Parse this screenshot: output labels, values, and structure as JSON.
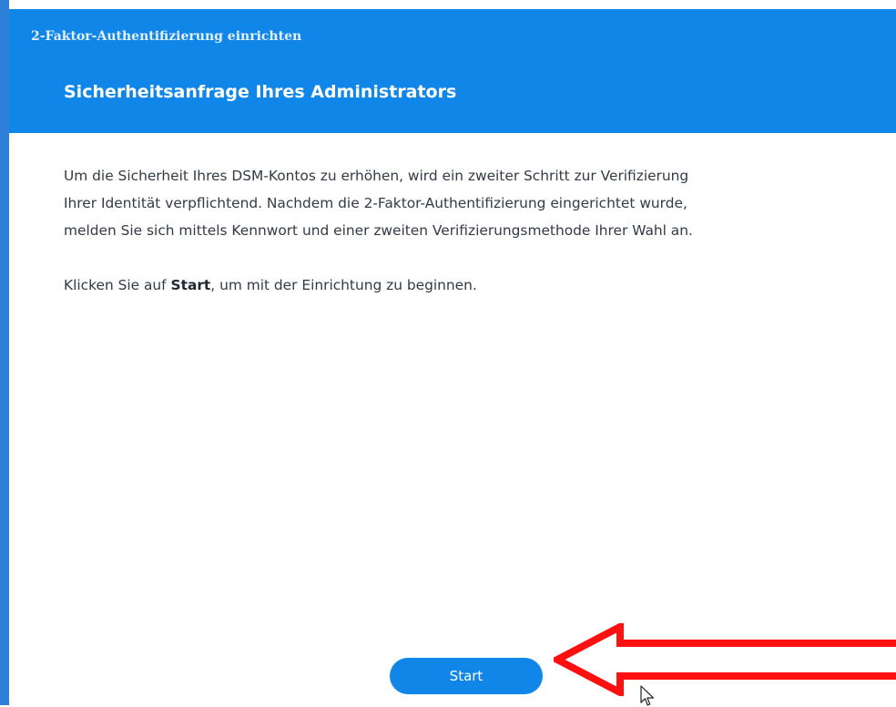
{
  "window": {
    "title": "2-Faktor-Authentifizierung einrichten"
  },
  "header": {
    "title": "Sicherheitsanfrage Ihres Administrators"
  },
  "content": {
    "description_lines": [
      "Um die Sicherheit Ihres DSM-Kontos zu erhöhen, wird ein zweiter Schritt zur Verifizierung",
      "Ihrer Identität verpflichtend. Nachdem die 2-Faktor-Authentifizierung eingerichtet wurde,",
      "melden Sie sich mittels Kennwort und einer zweiten Verifizierungsmethode Ihrer Wahl an."
    ],
    "instruction_prefix": "Klicken Sie auf ",
    "instruction_bold": "Start",
    "instruction_suffix": ", um mit der Einrichtung zu beginnen."
  },
  "footer": {
    "start_label": "Start"
  },
  "icons": {
    "annotation": "red-arrow-icon",
    "cursor": "mouse-pointer-icon"
  },
  "colors": {
    "header_blue": "#0f86e8",
    "button_blue": "#0f86e8",
    "text": "#313a46",
    "annotation_red": "#ff1010"
  }
}
